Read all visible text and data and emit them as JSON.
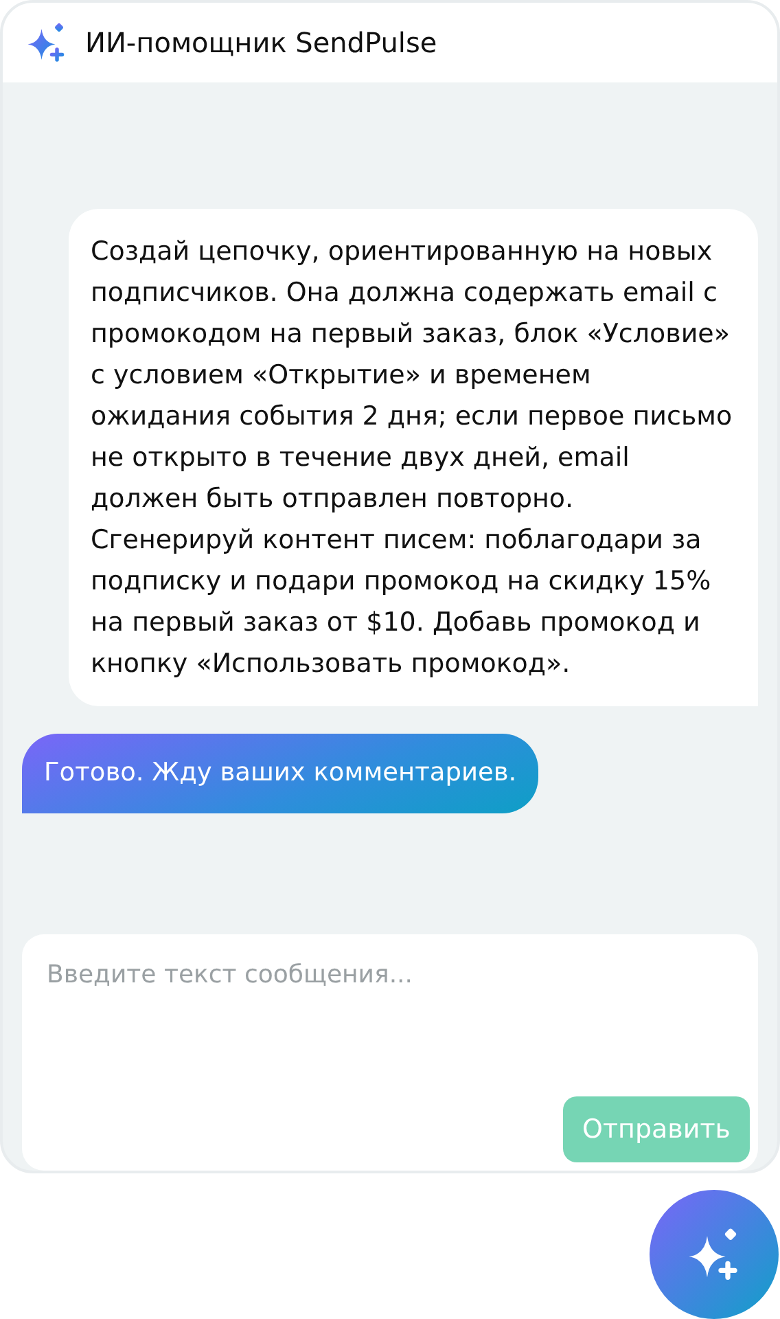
{
  "header": {
    "title": "ИИ-помощник SendPulse"
  },
  "messages": [
    {
      "kind": "user",
      "text": "Создай цепочку, ориентированную на новых подписчиков. Она должна содержать email с промокодом на первый заказ, блок «Условие» с условием «Открытие» и временем ожидания события 2 дня; если первое письмо не открыто в течение двух дней, email должен быть отправлен повторно. Сгенерируй контент писем: поблагодари за подписку и подари промокод на скидку 15% на первый заказ от $10. Добавь промокод и кнопку «Использовать промокод»."
    },
    {
      "kind": "bot",
      "text": "Готово. Жду ваших комментариев."
    }
  ],
  "composer": {
    "placeholder": "Введите текст сообщения...",
    "send_button": {
      "label": "Отправить",
      "disabled": true
    }
  }
}
